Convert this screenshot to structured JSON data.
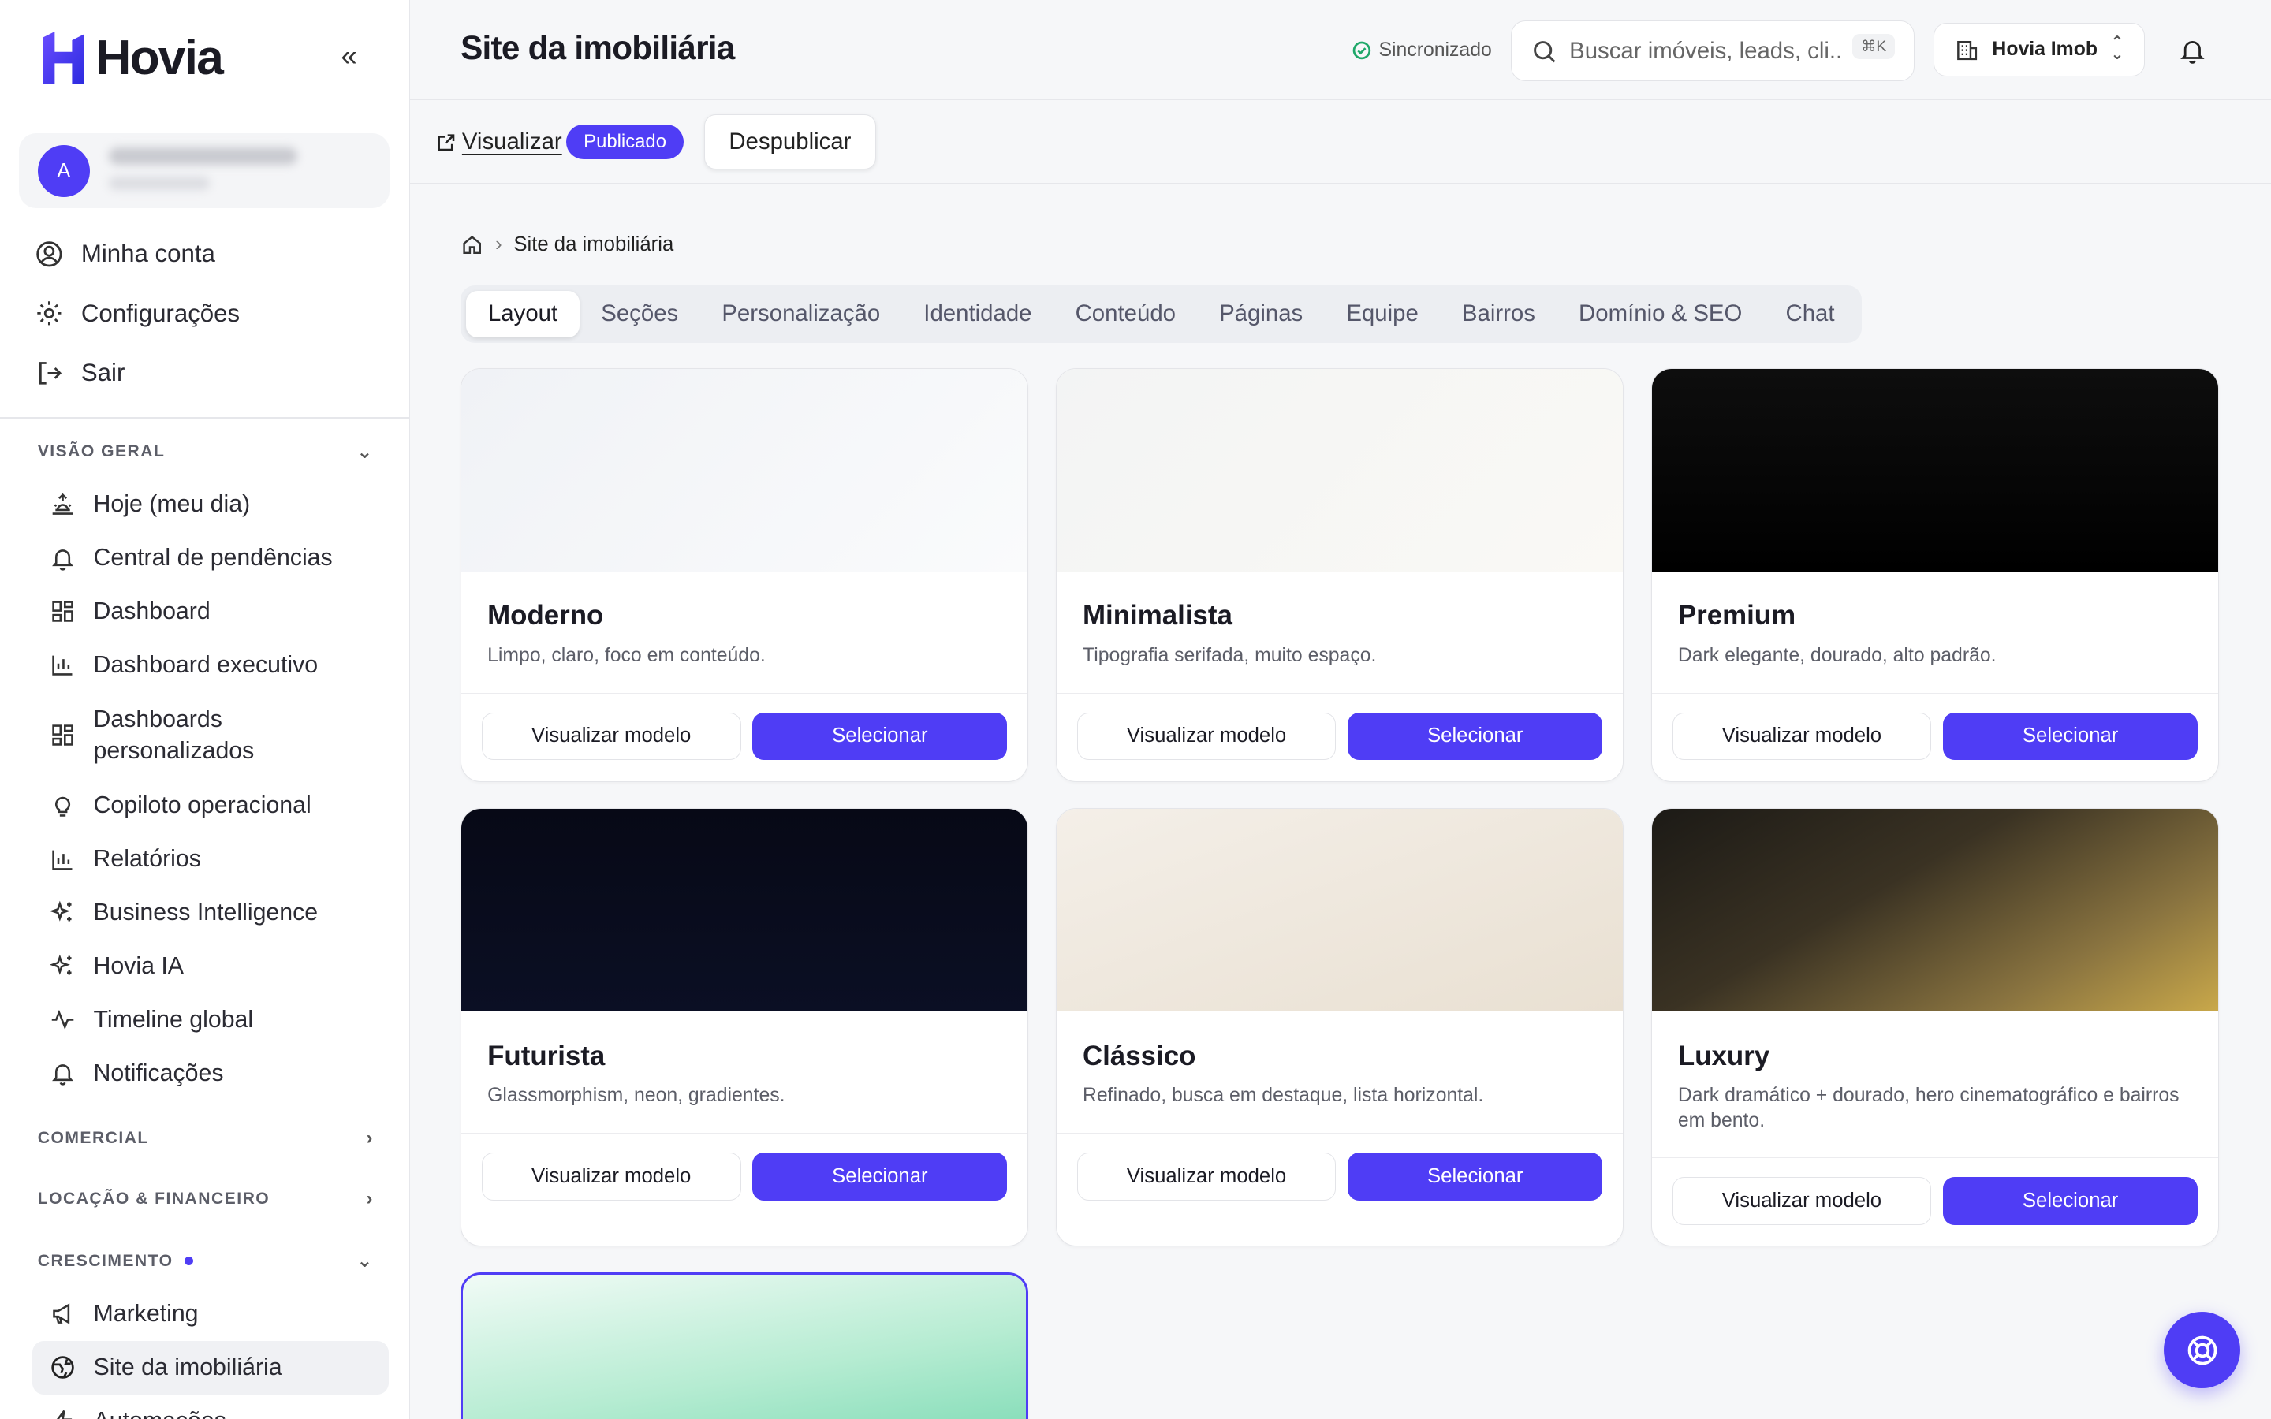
{
  "app": {
    "name": "Hovia",
    "brand_color": "#4f3df5"
  },
  "account": {
    "avatar_initial": "A"
  },
  "account_menu": [
    {
      "label": "Minha conta",
      "icon": "user-circle-icon"
    },
    {
      "label": "Configurações",
      "icon": "gear-icon"
    },
    {
      "label": "Sair",
      "icon": "logout-icon"
    }
  ],
  "sections": {
    "overview": {
      "title": "VISÃO GERAL",
      "items": [
        {
          "label": "Hoje (meu dia)",
          "icon": "sunrise-icon"
        },
        {
          "label": "Central de pendências",
          "icon": "bell-icon"
        },
        {
          "label": "Dashboard",
          "icon": "grid-icon"
        },
        {
          "label": "Dashboard executivo",
          "icon": "bar-chart-icon"
        },
        {
          "label": "Dashboards personalizados",
          "icon": "grid-icon"
        },
        {
          "label": "Copiloto operacional",
          "icon": "lightbulb-icon"
        },
        {
          "label": "Relatórios",
          "icon": "bar-chart-icon"
        },
        {
          "label": "Business Intelligence",
          "icon": "sparkles-icon"
        },
        {
          "label": "Hovia IA",
          "icon": "sparkles-icon"
        },
        {
          "label": "Timeline global",
          "icon": "activity-icon"
        },
        {
          "label": "Notificações",
          "icon": "bell-icon"
        }
      ]
    },
    "commercial": {
      "title": "COMERCIAL"
    },
    "finance": {
      "title": "LOCAÇÃO & FINANCEIRO"
    },
    "growth": {
      "title": "CRESCIMENTO",
      "items": [
        {
          "label": "Marketing",
          "icon": "megaphone-icon"
        },
        {
          "label": "Site da imobiliária",
          "icon": "globe-icon"
        },
        {
          "label": "Automações",
          "icon": "bolt-icon"
        }
      ]
    }
  },
  "header": {
    "title": "Site da imobiliária",
    "sync_status": "Sincronizado",
    "search_placeholder": "Buscar imóveis, leads, cli...",
    "search_shortcut": "⌘K",
    "org_name": "Hovia Imob"
  },
  "actionbar": {
    "preview_label": "Visualizar",
    "status_badge": "Publicado",
    "unpublish_label": "Despublicar"
  },
  "breadcrumb": {
    "current": "Site da imobiliária"
  },
  "tabs": [
    "Layout",
    "Seções",
    "Personalização",
    "Identidade",
    "Conteúdo",
    "Páginas",
    "Equipe",
    "Bairros",
    "Domínio & SEO",
    "Chat"
  ],
  "active_tab": "Layout",
  "templates": [
    {
      "name": "Moderno",
      "desc": "Limpo, claro, foco em conteúdo.",
      "preview_label": "Visualizar modelo",
      "select_label": "Selecionar"
    },
    {
      "name": "Minimalista",
      "desc": "Tipografia serifada, muito espaço.",
      "preview_label": "Visualizar modelo",
      "select_label": "Selecionar"
    },
    {
      "name": "Premium",
      "desc": "Dark elegante, dourado, alto padrão.",
      "preview_label": "Visualizar modelo",
      "select_label": "Selecionar"
    },
    {
      "name": "Futurista",
      "desc": "Glassmorphism, neon, gradientes.",
      "preview_label": "Visualizar modelo",
      "select_label": "Selecionar"
    },
    {
      "name": "Clássico",
      "desc": "Refinado, busca em destaque, lista horizontal.",
      "preview_label": "Visualizar modelo",
      "select_label": "Selecionar"
    },
    {
      "name": "Luxury",
      "desc": "Dark dramático + dourado, hero cinematográfico e bairros em bento.",
      "preview_label": "Visualizar modelo",
      "select_label": "Selecionar"
    }
  ]
}
